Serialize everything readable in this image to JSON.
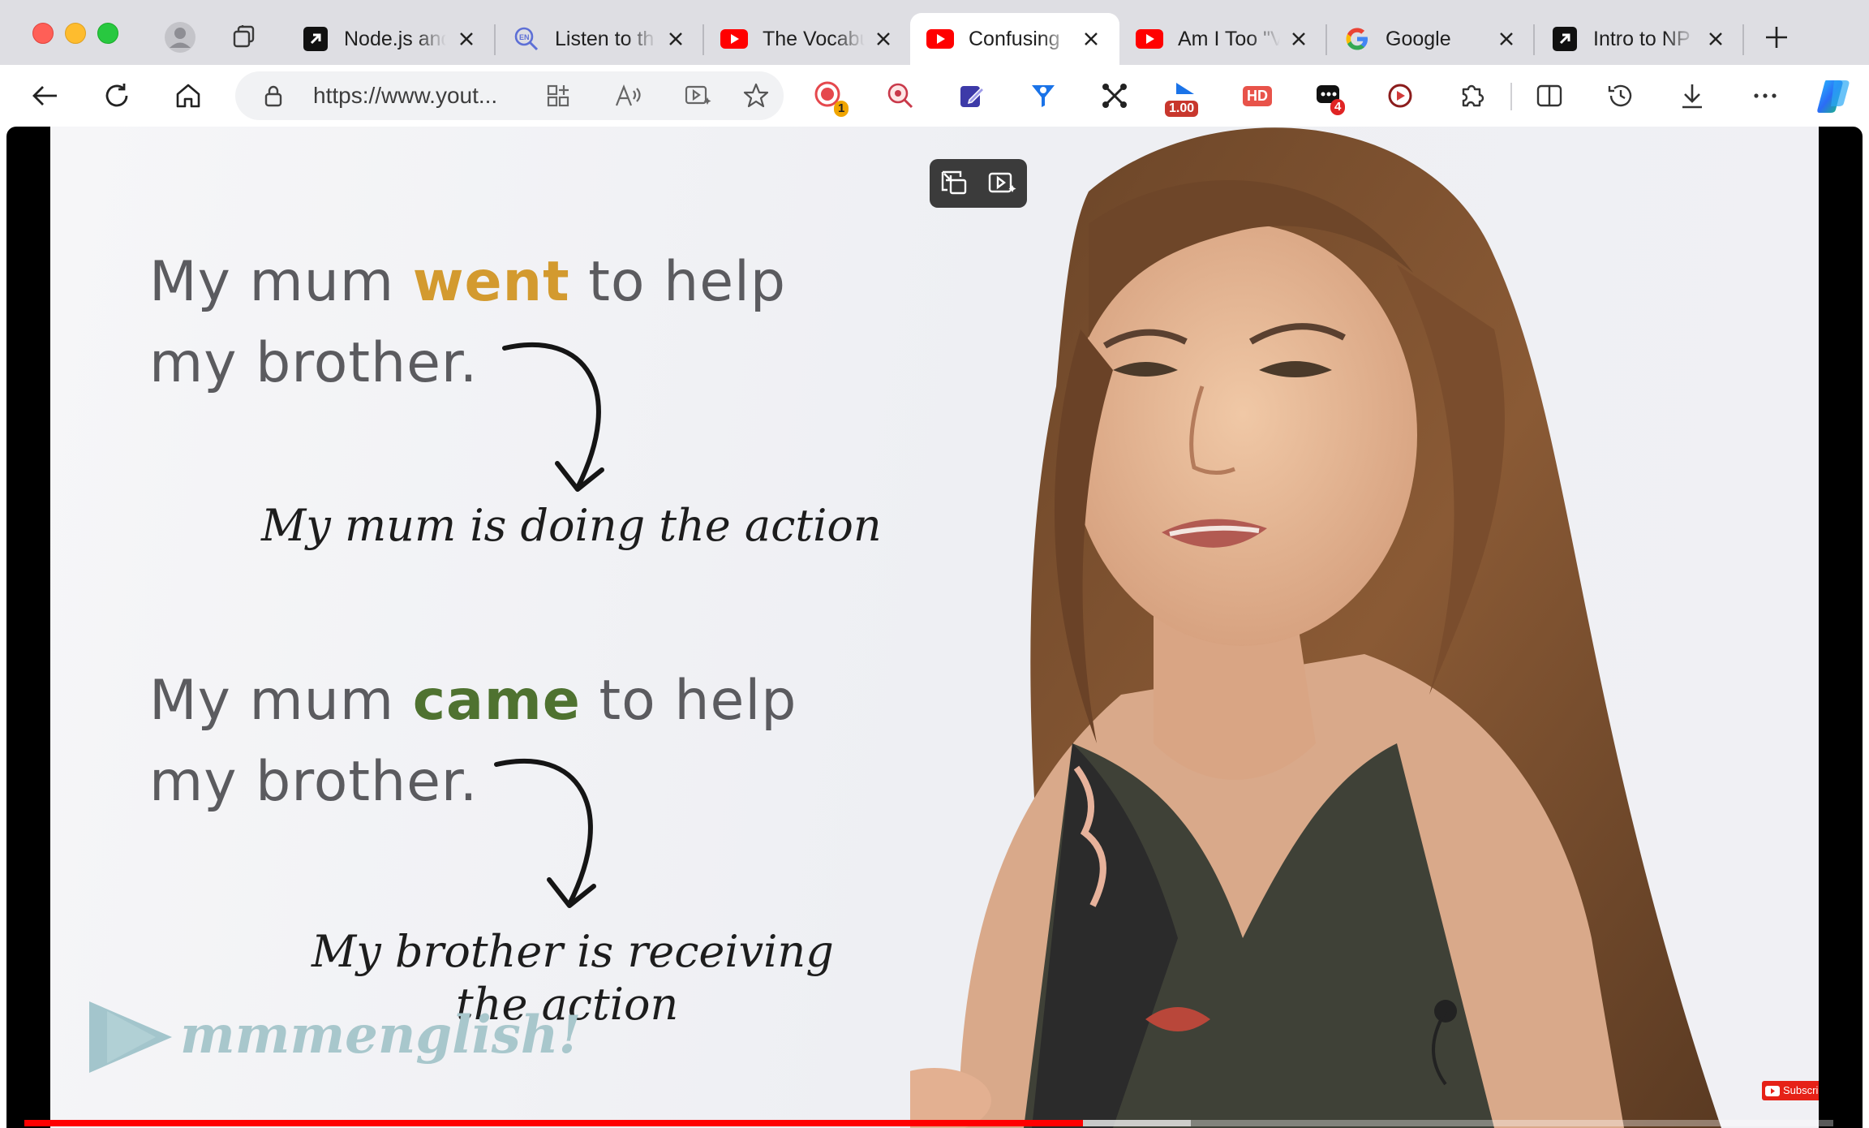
{
  "browser": {
    "tabs": [
      {
        "title": "Node.js and",
        "favicon": "external-link-icon",
        "active": false
      },
      {
        "title": "Listen to th",
        "favicon": "language-search-icon",
        "active": false
      },
      {
        "title": "The Vocabu",
        "favicon": "youtube-icon",
        "active": false
      },
      {
        "title": "Confusing",
        "favicon": "youtube-icon",
        "active": true
      },
      {
        "title": "Am I Too \"V",
        "favicon": "youtube-icon",
        "active": false
      },
      {
        "title": "Google",
        "favicon": "google-icon",
        "active": false
      },
      {
        "title": "Intro to NP",
        "favicon": "external-link-icon",
        "active": false
      }
    ],
    "address": {
      "url": "https://www.yout..."
    },
    "extensions": {
      "screen_recorder_badge": "1",
      "playback_speed": "1.00",
      "hd_label": "HD",
      "notes_badge": "4"
    },
    "colors": {
      "accent_red": "#ff0000",
      "youtube_red": "#ff0000",
      "tab_strip": "#dedee3"
    }
  },
  "video": {
    "slide": {
      "sentence1_part1": "My mum ",
      "sentence1_keyword": "went",
      "sentence1_part2": " to help",
      "sentence1_line2": "my brother.",
      "note1": "My mum is doing the action",
      "sentence2_part1": "My mum ",
      "sentence2_keyword": "came",
      "sentence2_part2": " to help",
      "sentence2_line2": "my brother.",
      "note2_line1": "My brother is receiving",
      "note2_line2": "the action",
      "keyword1_color": "#d39a2f",
      "keyword2_color": "#4f7230"
    },
    "brand_logo": "mmmenglish!",
    "subscribe_label": "Subscribe",
    "progress": 0.585,
    "buffered": 0.06
  }
}
